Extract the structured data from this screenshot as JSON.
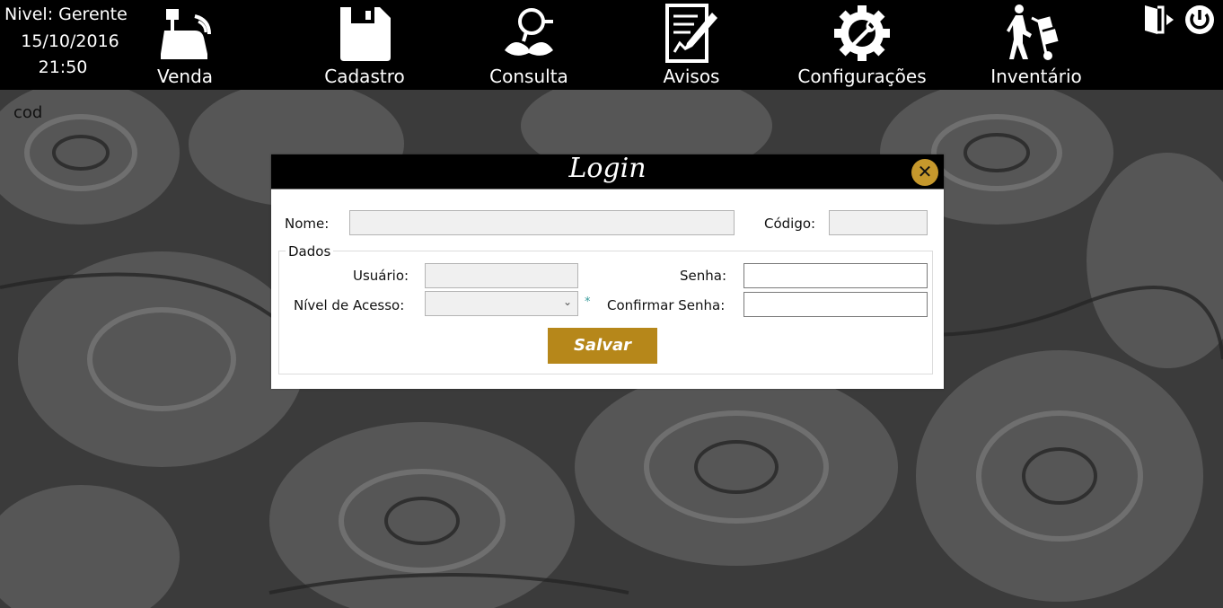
{
  "status": {
    "level": "Nivel: Gerente",
    "date": "15/10/2016",
    "time": "21:50"
  },
  "nav": [
    {
      "label": "Venda",
      "icon": "cash-register-icon"
    },
    {
      "label": "Cadastro",
      "icon": "save-icon"
    },
    {
      "label": "Consulta",
      "icon": "detective-icon"
    },
    {
      "label": "Avisos",
      "icon": "notes-pencil-icon"
    },
    {
      "label": "Configurações",
      "icon": "gear-wrench-icon"
    },
    {
      "label": "Inventário",
      "icon": "hand-truck-icon"
    }
  ],
  "top_right": {
    "exit_icon": "exit-door-icon",
    "power_icon": "power-icon"
  },
  "page": {
    "cod_label": "cod"
  },
  "dialog": {
    "title": "Login",
    "close_icon": "close-icon",
    "name_label": "Nome:",
    "name_value": "",
    "code_label": "Código:",
    "code_value": "",
    "group_legend": "Dados",
    "user_label": "Usuário:",
    "user_value": "",
    "password_label": "Senha:",
    "password_value": "",
    "access_label": "Nível de Acesso:",
    "access_value": "",
    "required_mark": "*",
    "confirm_label": "Confirmar Senha:",
    "confirm_value": "",
    "save_label": "Salvar"
  },
  "colors": {
    "topbar": "#000000",
    "accent": "#b6871a",
    "close_button": "#c6982c",
    "dialog_header": "#000000"
  }
}
